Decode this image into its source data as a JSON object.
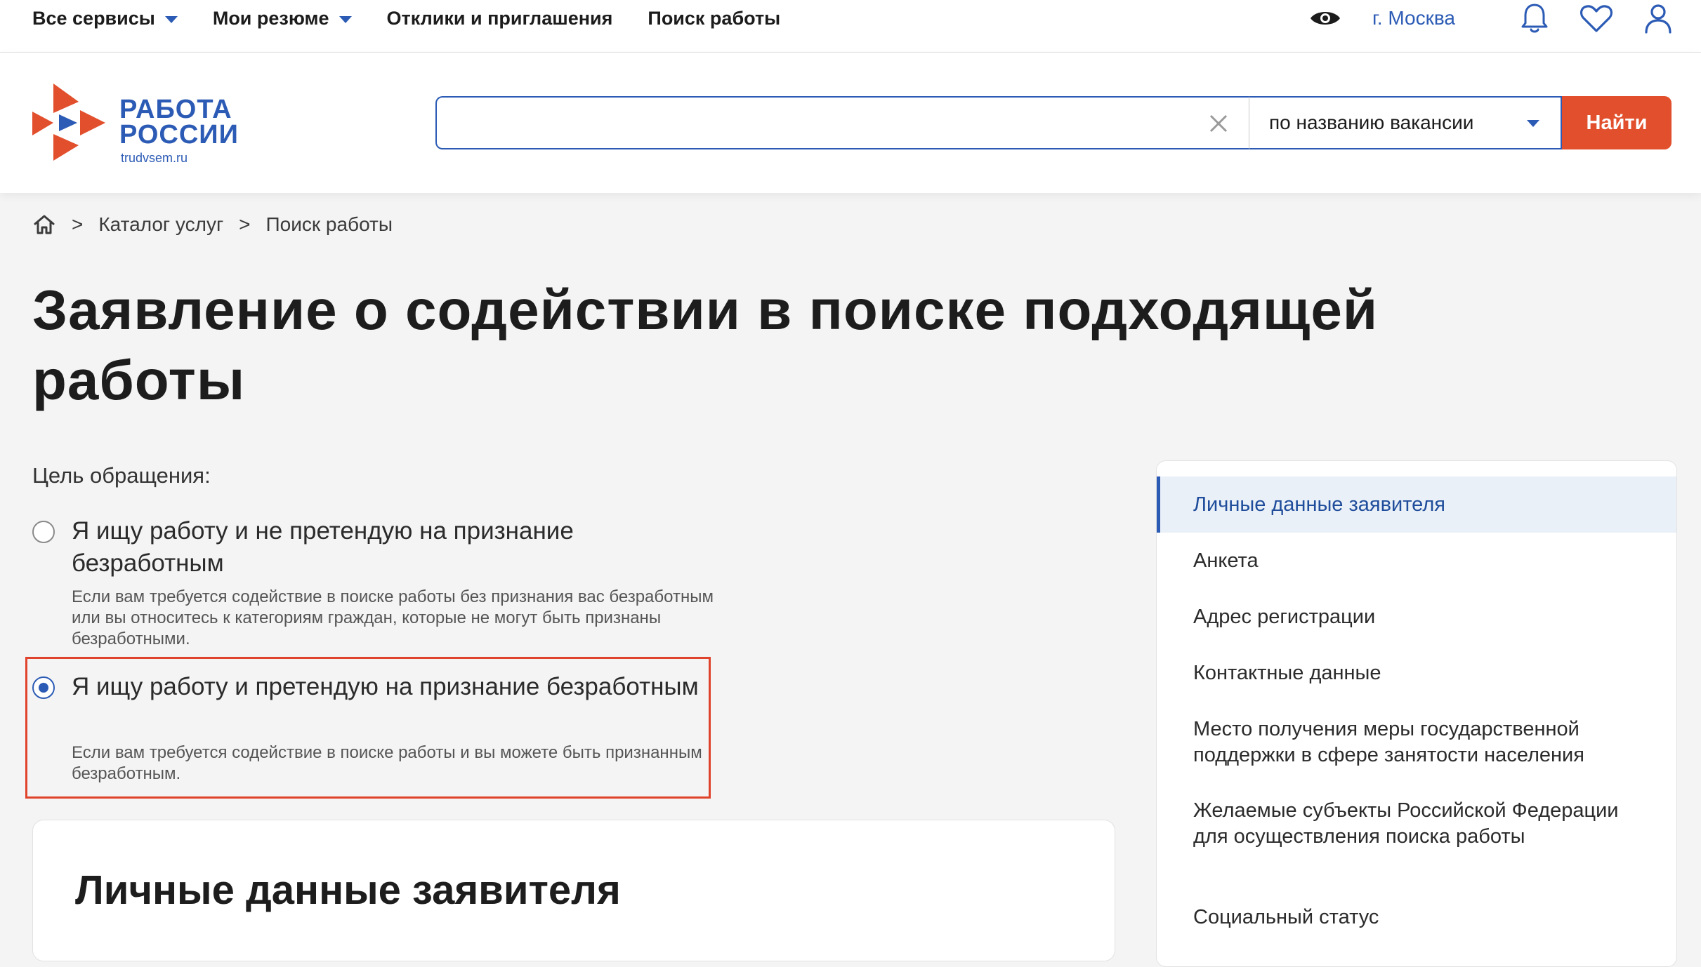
{
  "topnav": {
    "items": [
      {
        "label": "Все сервисы",
        "has_dropdown": true
      },
      {
        "label": "Мои резюме",
        "has_dropdown": true
      },
      {
        "label": "Отклики и приглашения",
        "has_dropdown": false
      },
      {
        "label": "Поиск работы",
        "has_dropdown": false
      }
    ],
    "city": "г. Москва",
    "icons": [
      "eye-icon",
      "bell-icon",
      "heart-icon",
      "user-icon"
    ]
  },
  "logo": {
    "line1": "РАБОТА",
    "line2": "РОССИИ",
    "url": "trudvsem.ru"
  },
  "search": {
    "value": "",
    "placeholder": "",
    "mode": "по названию вакансии",
    "button": "Найти"
  },
  "breadcrumb": {
    "items": [
      "Каталог услуг",
      "Поиск работы"
    ],
    "separator": ">"
  },
  "page": {
    "title": "Заявление о содействии в поиске подходящей работы",
    "purpose_label": "Цель обращения:"
  },
  "options": [
    {
      "title": "Я ищу работу и не претендую на признание безработным",
      "description": "Если вам требуется содействие в поиске работы без признания вас безработным или вы относитесь к категориям граждан, которые не могут быть признаны безработными.",
      "selected": false
    },
    {
      "title": "Я ищу работу и претендую на признание безработным",
      "description": "Если вам требуется содействие в поиске работы и вы можете быть признанным безработным.",
      "selected": true
    }
  ],
  "form_section": {
    "title": "Личные данные заявителя"
  },
  "sidenav": {
    "items": [
      "Личные данные заявителя",
      "Анкета",
      "Адрес регистрации",
      "Контактные данные",
      "Место получения меры государственной поддержки в сфере занятости населения",
      "Желаемые субъекты Российской Федерации для осуществления поиска работы",
      "Социальный статус"
    ],
    "active_index": 0
  },
  "colors": {
    "brand_blue": "#2c5bb5",
    "brand_orange": "#e24f2c",
    "highlight_red": "#e0432b"
  }
}
